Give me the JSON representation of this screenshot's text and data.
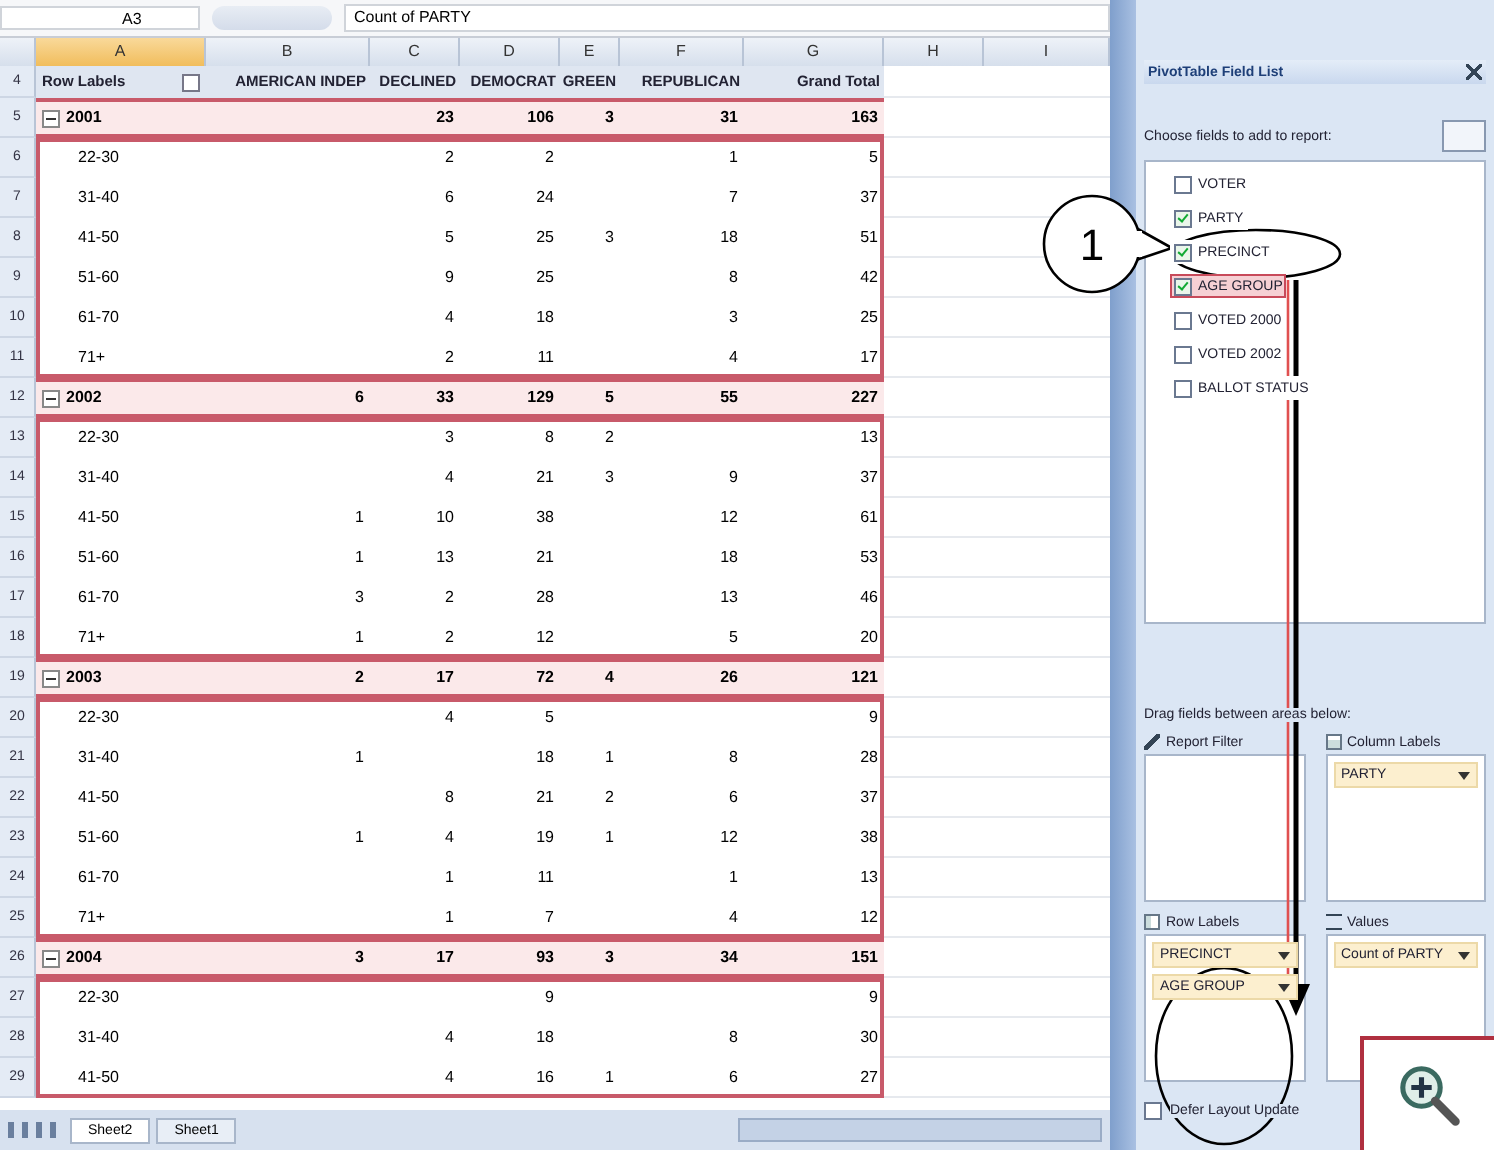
{
  "formula_bar": {
    "cell": "A3",
    "formula": "Count of PARTY"
  },
  "columns": [
    {
      "label": "A",
      "selected": true
    },
    {
      "label": "B",
      "selected": false
    },
    {
      "label": "C",
      "selected": false
    },
    {
      "label": "D",
      "selected": false
    },
    {
      "label": "E",
      "selected": false
    },
    {
      "label": "F",
      "selected": false
    },
    {
      "label": "G",
      "selected": false
    },
    {
      "label": "H",
      "selected": false
    },
    {
      "label": "I",
      "selected": false
    }
  ],
  "row_numbers": [
    "4",
    "5",
    "6",
    "7",
    "8",
    "9",
    "10",
    "11",
    "12",
    "13",
    "14",
    "15",
    "16",
    "17",
    "18",
    "19",
    "20",
    "21",
    "22",
    "23",
    "24",
    "25",
    "26",
    "27",
    "28",
    "29"
  ],
  "pivot": {
    "row_labels": "Row Labels",
    "headers": [
      "AMERICAN INDEP",
      "DECLINED",
      "DEMOCRAT",
      "GREEN",
      "REPUBLICAN",
      "Grand Total"
    ],
    "groups": [
      {
        "label": "2001",
        "expanded": true,
        "values": [
          {
            "kind": "blank"
          },
          {
            "kind": "count",
            "text": "23"
          },
          {
            "kind": "count",
            "text": "106"
          },
          {
            "kind": "count",
            "text": "3"
          },
          {
            "kind": "count",
            "text": "31"
          },
          {
            "kind": "count",
            "text": "163"
          }
        ],
        "items": [
          {
            "label": "22-30",
            "values": [
              {
                "kind": "blank"
              },
              {
                "kind": "count",
                "text": "2"
              },
              {
                "kind": "count",
                "text": "2"
              },
              {
                "kind": "blank"
              },
              {
                "kind": "count",
                "text": "1"
              },
              {
                "kind": "count",
                "text": "5"
              }
            ]
          },
          {
            "label": "31-40",
            "values": [
              {
                "kind": "blank"
              },
              {
                "kind": "count",
                "text": "6"
              },
              {
                "kind": "count",
                "text": "24"
              },
              {
                "kind": "blank"
              },
              {
                "kind": "count",
                "text": "7"
              },
              {
                "kind": "count",
                "text": "37"
              }
            ]
          },
          {
            "label": "41-50",
            "values": [
              {
                "kind": "blank"
              },
              {
                "kind": "count",
                "text": "5"
              },
              {
                "kind": "count",
                "text": "25"
              },
              {
                "kind": "count",
                "text": "3"
              },
              {
                "kind": "count",
                "text": "18"
              },
              {
                "kind": "count",
                "text": "51"
              }
            ]
          },
          {
            "label": "51-60",
            "values": [
              {
                "kind": "blank"
              },
              {
                "kind": "count",
                "text": "9"
              },
              {
                "kind": "count",
                "text": "25"
              },
              {
                "kind": "blank"
              },
              {
                "kind": "count",
                "text": "8"
              },
              {
                "kind": "count",
                "text": "42"
              }
            ]
          },
          {
            "label": "61-70",
            "values": [
              {
                "kind": "blank"
              },
              {
                "kind": "count",
                "text": "4"
              },
              {
                "kind": "count",
                "text": "18"
              },
              {
                "kind": "blank"
              },
              {
                "kind": "count",
                "text": "3"
              },
              {
                "kind": "count",
                "text": "25"
              }
            ]
          },
          {
            "label": "71+",
            "values": [
              {
                "kind": "blank"
              },
              {
                "kind": "count",
                "text": "2"
              },
              {
                "kind": "count",
                "text": "11"
              },
              {
                "kind": "blank"
              },
              {
                "kind": "count",
                "text": "4"
              },
              {
                "kind": "count",
                "text": "17"
              }
            ]
          }
        ]
      },
      {
        "label": "2002",
        "expanded": true,
        "values": [
          {
            "kind": "count",
            "text": "6"
          },
          {
            "kind": "count",
            "text": "33"
          },
          {
            "kind": "count",
            "text": "129"
          },
          {
            "kind": "count",
            "text": "5"
          },
          {
            "kind": "count",
            "text": "55"
          },
          {
            "kind": "count",
            "text": "227"
          }
        ],
        "items": [
          {
            "label": "22-30",
            "values": [
              {
                "kind": "blank"
              },
              {
                "kind": "count",
                "text": "3"
              },
              {
                "kind": "count",
                "text": "8"
              },
              {
                "kind": "count",
                "text": "2"
              },
              {
                "kind": "blank"
              },
              {
                "kind": "count",
                "text": "13"
              }
            ]
          },
          {
            "label": "31-40",
            "values": [
              {
                "kind": "blank"
              },
              {
                "kind": "count",
                "text": "4"
              },
              {
                "kind": "count",
                "text": "21"
              },
              {
                "kind": "count",
                "text": "3"
              },
              {
                "kind": "count",
                "text": "9"
              },
              {
                "kind": "count",
                "text": "37"
              }
            ]
          },
          {
            "label": "41-50",
            "values": [
              {
                "kind": "count",
                "text": "1"
              },
              {
                "kind": "count",
                "text": "10"
              },
              {
                "kind": "count",
                "text": "38"
              },
              {
                "kind": "blank"
              },
              {
                "kind": "count",
                "text": "12"
              },
              {
                "kind": "count",
                "text": "61"
              }
            ]
          },
          {
            "label": "51-60",
            "values": [
              {
                "kind": "count",
                "text": "1"
              },
              {
                "kind": "count",
                "text": "13"
              },
              {
                "kind": "count",
                "text": "21"
              },
              {
                "kind": "blank"
              },
              {
                "kind": "count",
                "text": "18"
              },
              {
                "kind": "count",
                "text": "53"
              }
            ]
          },
          {
            "label": "61-70",
            "values": [
              {
                "kind": "count",
                "text": "3"
              },
              {
                "kind": "count",
                "text": "2"
              },
              {
                "kind": "count",
                "text": "28"
              },
              {
                "kind": "blank"
              },
              {
                "kind": "count",
                "text": "13"
              },
              {
                "kind": "count",
                "text": "46"
              }
            ]
          },
          {
            "label": "71+",
            "values": [
              {
                "kind": "count",
                "text": "1"
              },
              {
                "kind": "count",
                "text": "2"
              },
              {
                "kind": "count",
                "text": "12"
              },
              {
                "kind": "blank"
              },
              {
                "kind": "count",
                "text": "5"
              },
              {
                "kind": "count",
                "text": "20"
              }
            ]
          }
        ]
      },
      {
        "label": "2003",
        "expanded": true,
        "values": [
          {
            "kind": "count",
            "text": "2"
          },
          {
            "kind": "count",
            "text": "17"
          },
          {
            "kind": "count",
            "text": "72"
          },
          {
            "kind": "count",
            "text": "4"
          },
          {
            "kind": "count",
            "text": "26"
          },
          {
            "kind": "count",
            "text": "121"
          }
        ],
        "items": [
          {
            "label": "22-30",
            "values": [
              {
                "kind": "blank"
              },
              {
                "kind": "count",
                "text": "4"
              },
              {
                "kind": "count",
                "text": "5"
              },
              {
                "kind": "blank"
              },
              {
                "kind": "blank"
              },
              {
                "kind": "count",
                "text": "9"
              }
            ]
          },
          {
            "label": "31-40",
            "values": [
              {
                "kind": "count",
                "text": "1"
              },
              {
                "kind": "blank"
              },
              {
                "kind": "count",
                "text": "18"
              },
              {
                "kind": "count",
                "text": "1"
              },
              {
                "kind": "count",
                "text": "8"
              },
              {
                "kind": "count",
                "text": "28"
              }
            ]
          },
          {
            "label": "41-50",
            "values": [
              {
                "kind": "blank"
              },
              {
                "kind": "count",
                "text": "8"
              },
              {
                "kind": "count",
                "text": "21"
              },
              {
                "kind": "count",
                "text": "2"
              },
              {
                "kind": "count",
                "text": "6"
              },
              {
                "kind": "count",
                "text": "37"
              }
            ]
          },
          {
            "label": "51-60",
            "values": [
              {
                "kind": "count",
                "text": "1"
              },
              {
                "kind": "count",
                "text": "4"
              },
              {
                "kind": "count",
                "text": "19"
              },
              {
                "kind": "count",
                "text": "1"
              },
              {
                "kind": "count",
                "text": "12"
              },
              {
                "kind": "count",
                "text": "38"
              }
            ]
          },
          {
            "label": "61-70",
            "values": [
              {
                "kind": "blank"
              },
              {
                "kind": "count",
                "text": "1"
              },
              {
                "kind": "count",
                "text": "11"
              },
              {
                "kind": "blank"
              },
              {
                "kind": "count",
                "text": "1"
              },
              {
                "kind": "count",
                "text": "13"
              }
            ]
          },
          {
            "label": "71+",
            "values": [
              {
                "kind": "blank"
              },
              {
                "kind": "count",
                "text": "1"
              },
              {
                "kind": "count",
                "text": "7"
              },
              {
                "kind": "blank"
              },
              {
                "kind": "count",
                "text": "4"
              },
              {
                "kind": "count",
                "text": "12"
              }
            ]
          }
        ]
      },
      {
        "label": "2004",
        "expanded": true,
        "values": [
          {
            "kind": "count",
            "text": "3"
          },
          {
            "kind": "count",
            "text": "17"
          },
          {
            "kind": "count",
            "text": "93"
          },
          {
            "kind": "count",
            "text": "3"
          },
          {
            "kind": "count",
            "text": "34"
          },
          {
            "kind": "count",
            "text": "151"
          }
        ],
        "items": [
          {
            "label": "22-30",
            "values": [
              {
                "kind": "blank"
              },
              {
                "kind": "blank"
              },
              {
                "kind": "count",
                "text": "9"
              },
              {
                "kind": "blank"
              },
              {
                "kind": "blank"
              },
              {
                "kind": "count",
                "text": "9"
              }
            ]
          },
          {
            "label": "31-40",
            "values": [
              {
                "kind": "blank"
              },
              {
                "kind": "count",
                "text": "4"
              },
              {
                "kind": "count",
                "text": "18"
              },
              {
                "kind": "blank"
              },
              {
                "kind": "count",
                "text": "8"
              },
              {
                "kind": "count",
                "text": "30"
              }
            ]
          },
          {
            "label": "41-50",
            "values": [
              {
                "kind": "blank"
              },
              {
                "kind": "count",
                "text": "4"
              },
              {
                "kind": "count",
                "text": "16"
              },
              {
                "kind": "count",
                "text": "1"
              },
              {
                "kind": "count",
                "text": "6"
              },
              {
                "kind": "count",
                "text": "27"
              }
            ]
          }
        ]
      }
    ]
  },
  "sheet_tabs": [
    {
      "label": "Sheet2",
      "selected": true
    },
    {
      "label": "Sheet1",
      "selected": false
    }
  ],
  "field_list": {
    "title": "PivotTable Field List",
    "prompt": "Choose fields to add to report:",
    "fields": [
      {
        "label": "VOTER",
        "checked": false,
        "selected": false
      },
      {
        "label": "PARTY",
        "checked": true,
        "selected": false
      },
      {
        "label": "PRECINCT",
        "checked": true,
        "selected": false
      },
      {
        "label": "AGE GROUP",
        "checked": true,
        "selected": true
      },
      {
        "label": "VOTED 2000",
        "checked": false,
        "selected": false
      },
      {
        "label": "VOTED 2002",
        "checked": false,
        "selected": false
      },
      {
        "label": "BALLOT STATUS",
        "checked": false,
        "selected": false
      }
    ],
    "drag_prompt": "Drag fields between areas below:",
    "areas": [
      {
        "kind": "filter",
        "label": "Report Filter"
      },
      {
        "kind": "columns",
        "label": "Column Labels",
        "items": [
          "PARTY"
        ]
      },
      {
        "kind": "rows",
        "label": "Row Labels",
        "items": [
          "PRECINCT",
          "AGE GROUP"
        ]
      },
      {
        "kind": "values",
        "label": "Values",
        "items": [
          "Count of PARTY"
        ]
      }
    ],
    "defer": {
      "label": "Defer Layout Update",
      "checked": false
    }
  },
  "annotation": {
    "label": "1"
  }
}
